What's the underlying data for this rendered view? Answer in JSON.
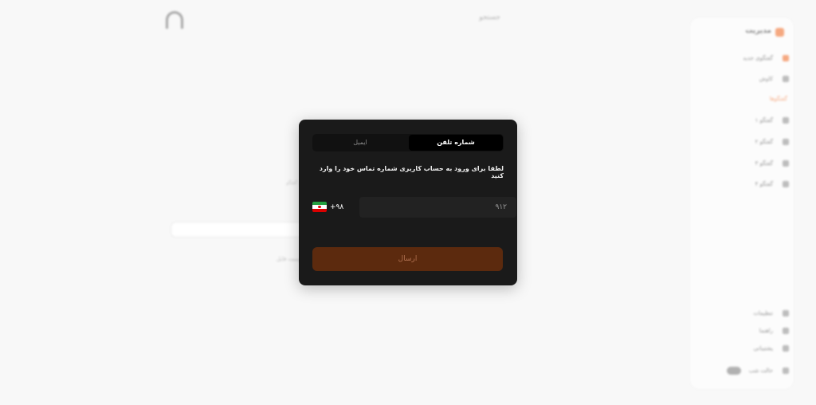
{
  "background": {
    "search_label": "جستجو",
    "brand": "مدیریت",
    "sidebar_items": [
      "گفتگوی جدید",
      "کاوش"
    ],
    "sidebar_heading": "گفتگوها",
    "sidebar_list": [
      "گفتگو ۱",
      "گفتگو ۲",
      "گفتگو ۳",
      "گفتگو ۴"
    ],
    "sidebar_footer": [
      "تنظیمات",
      "راهنما",
      "پشتیبانی",
      "حالت شب"
    ],
    "center_text": "شروع گفتگو",
    "center_links": "پیوست فایل"
  },
  "login_modal": {
    "tabs": [
      {
        "label": "شماره تلفن",
        "active": true
      },
      {
        "label": "ایمیل",
        "active": false
      }
    ],
    "instruction": "لطفا برای ورود به حساب کاربری شماره تماس خود را وارد کنید",
    "country_code": "+۹۸",
    "phone_placeholder": "۹۱۲",
    "phone_value": "",
    "submit_label": "ارسال"
  },
  "colors": {
    "accent": "#f07a3c",
    "submit_bg": "#5c2a0e",
    "modal_bg": "#1a1a1a"
  },
  "icons": {
    "flag": "iran-flag-icon",
    "logo": "app-logo-icon"
  }
}
